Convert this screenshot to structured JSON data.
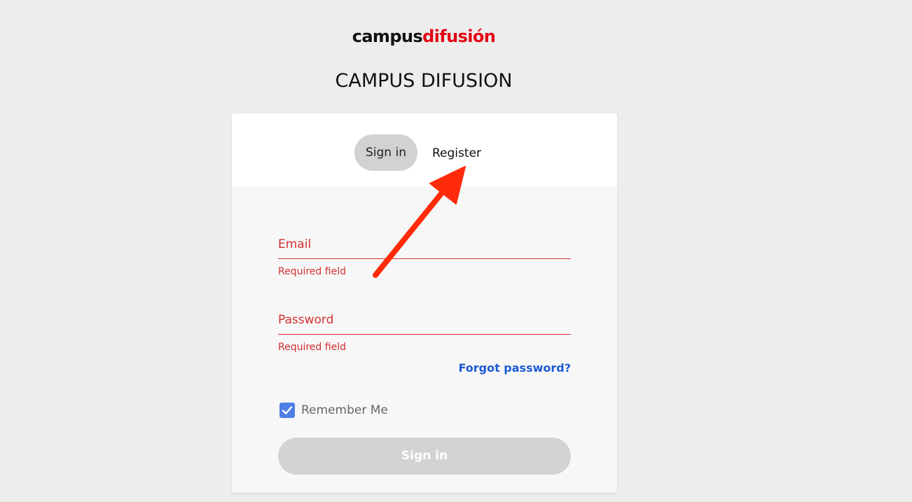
{
  "brand": {
    "logo_part1": "campus",
    "logo_part2": "difusión",
    "title": "CAMPUS DIFUSION",
    "accent_color": "#e30613"
  },
  "auth": {
    "tabs": {
      "sign_in": "Sign in",
      "register": "Register"
    },
    "email": {
      "label": "Email",
      "value": "",
      "error": "Required field"
    },
    "password": {
      "label": "Password",
      "value": "",
      "error": "Required field"
    },
    "forgot_password": "Forgot password?",
    "remember_me": {
      "label": "Remember Me",
      "checked": true
    },
    "submit_label": "Sign in"
  },
  "annotation": {
    "icon": "arrow-icon",
    "color": "#ff2a0a"
  },
  "colors": {
    "error": "#d32f2f",
    "link": "#1d5ad6",
    "checkbox": "#4f7ee6"
  }
}
